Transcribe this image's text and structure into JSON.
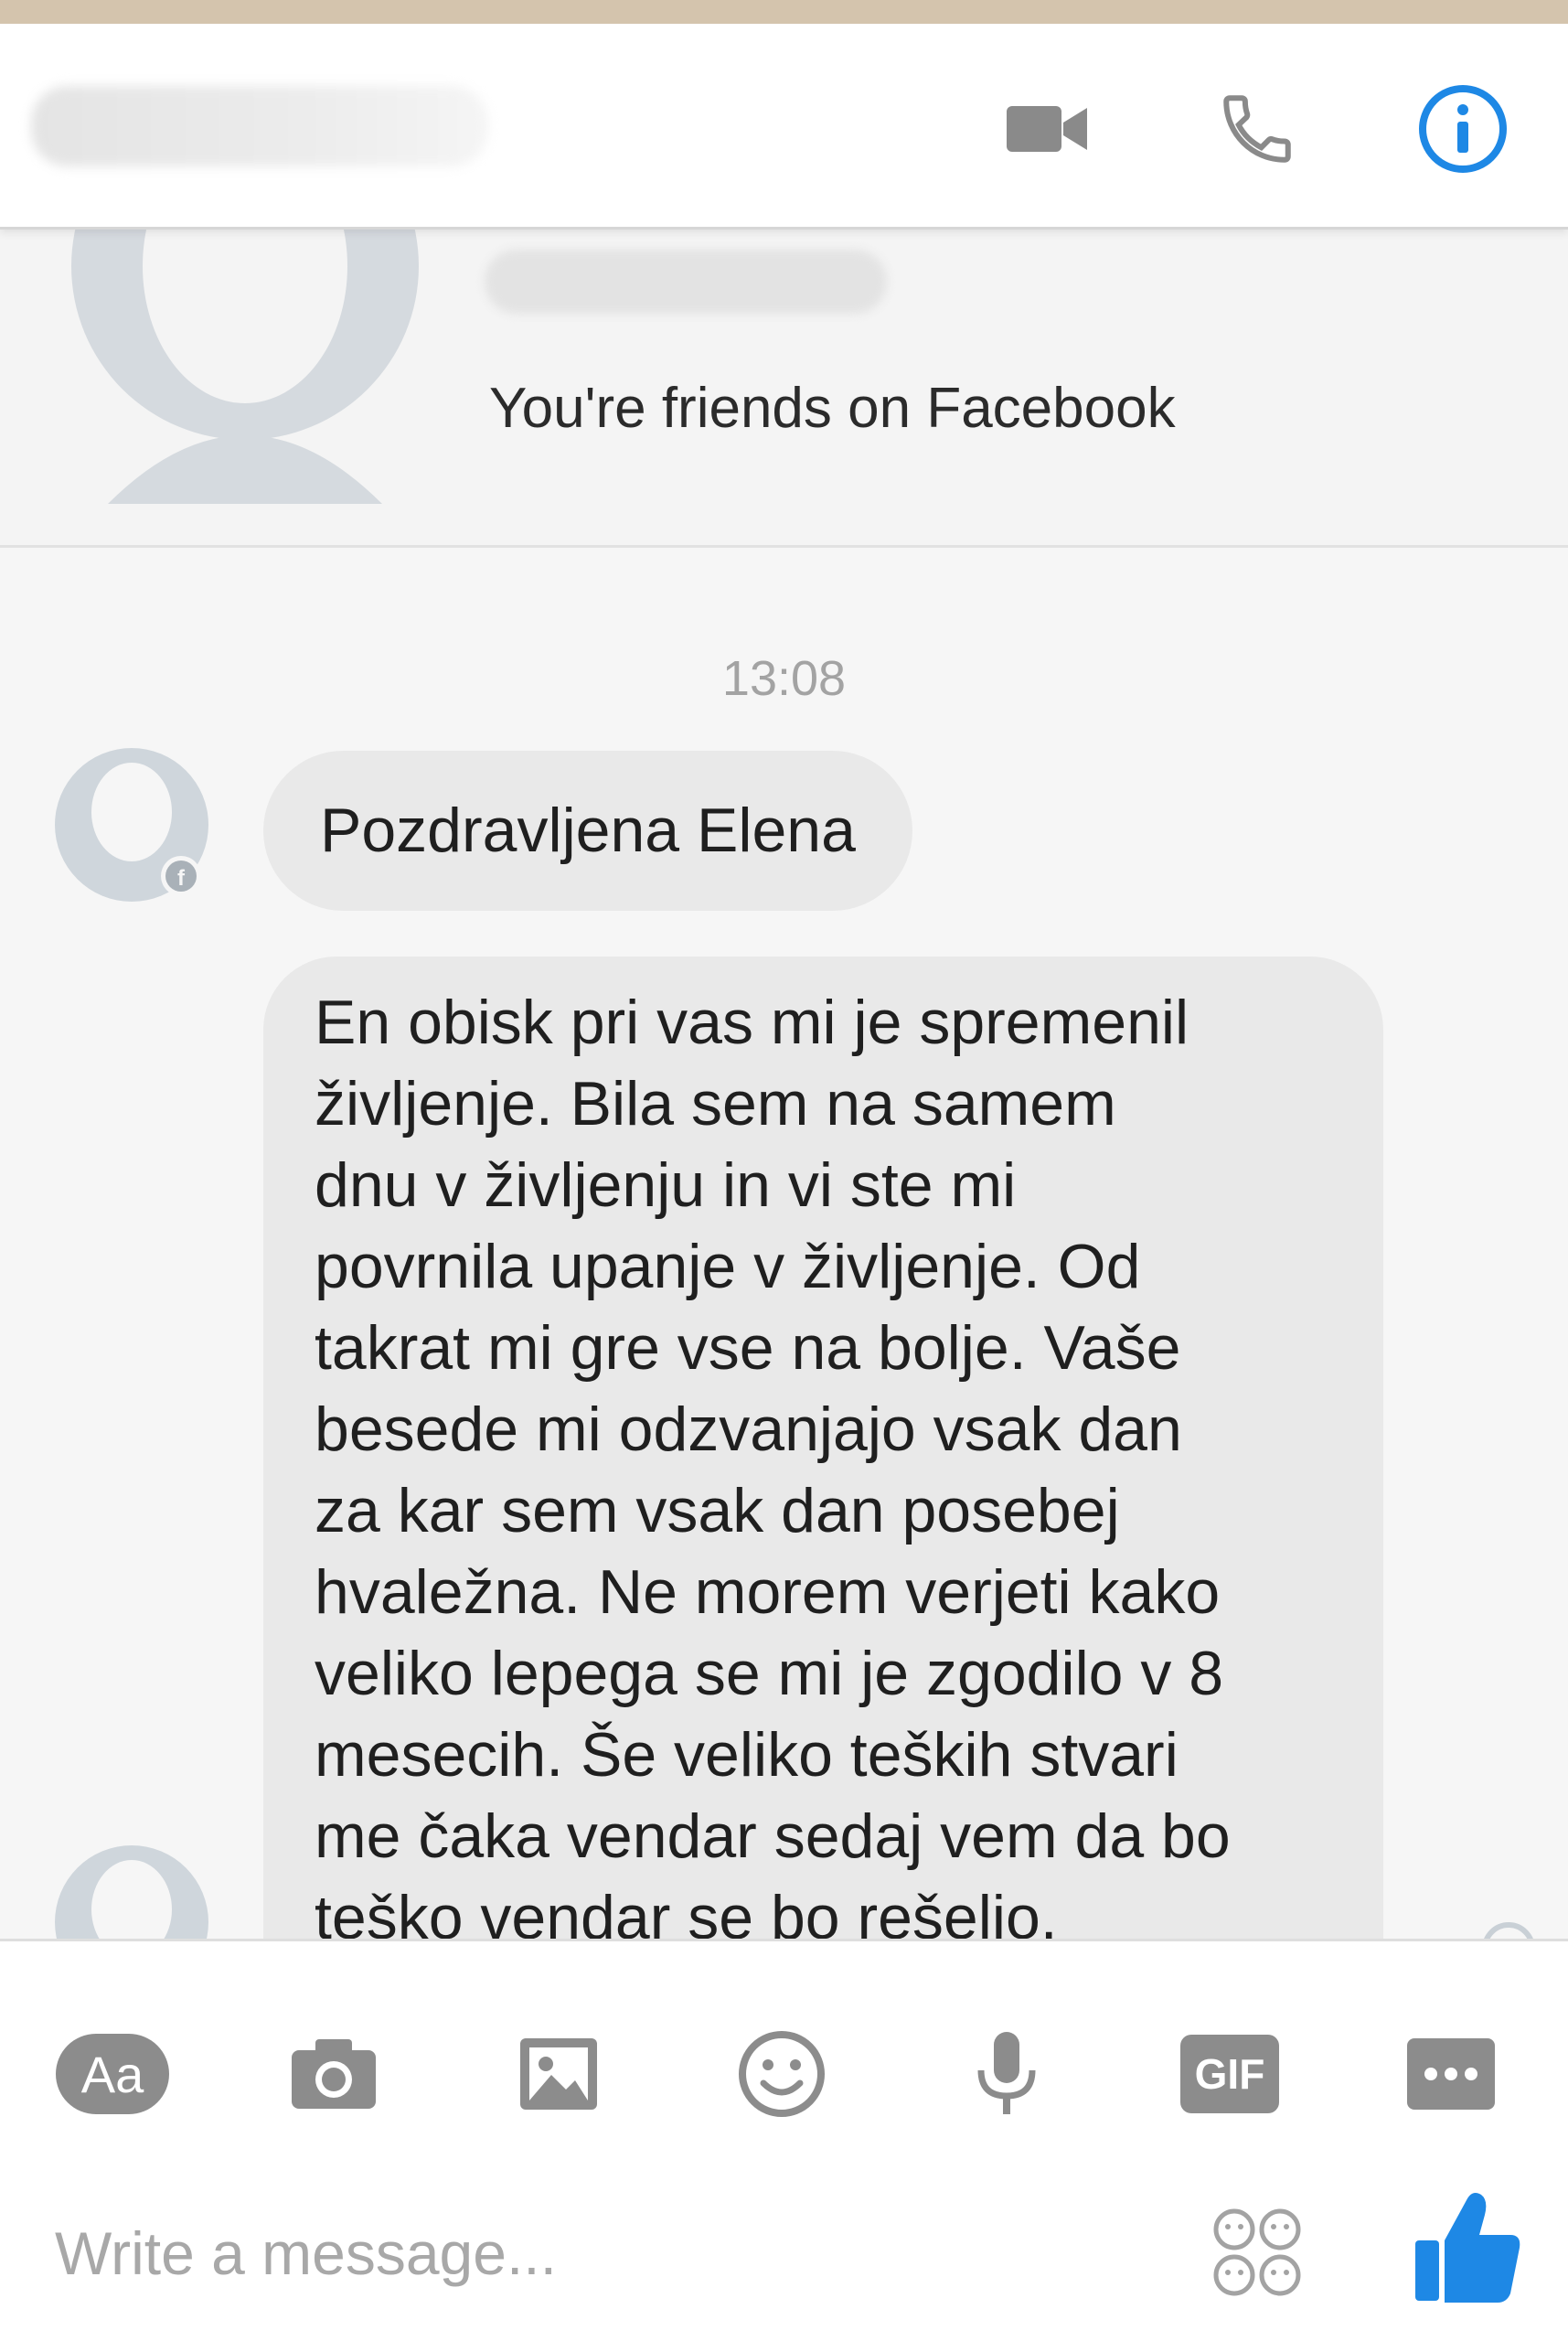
{
  "header": {
    "icons": {
      "video": "video-camera-icon",
      "call": "phone-icon",
      "info": "info-icon"
    },
    "accent_color": "#1e88e5",
    "icon_color": "#8a8a8a"
  },
  "profile": {
    "friends_text": "You're friends on Facebook"
  },
  "conversation": {
    "timestamp": "13:08",
    "messages": [
      {
        "text": "Pozdravljena Elena"
      },
      {
        "text": "En obisk pri vas mi je spremenil\nživljenje. Bila sem na samem\ndnu v življenju in vi ste mi\npovrnila upanje v življenje. Od\ntakrat mi gre vse na bolje. Vaše\nbesede mi odzvanjajo vsak dan\nza kar sem vsak dan posebej\nhvaležna. Ne morem verjeti kako\nveliko lepega se mi je zgodilo v 8\nmesecih. Še veliko teških stvari\nme čaka vendar sedaj vem da bo\nteško vendar se bo rešelio."
      }
    ]
  },
  "composer": {
    "aa_label": "Aa",
    "gif_label": "GIF",
    "placeholder": "Write a message...",
    "like_color": "#1e88e5",
    "tools": [
      "aa-icon",
      "camera-icon",
      "image-icon",
      "emoji-icon",
      "microphone-icon",
      "gif-icon",
      "more-icon"
    ]
  }
}
